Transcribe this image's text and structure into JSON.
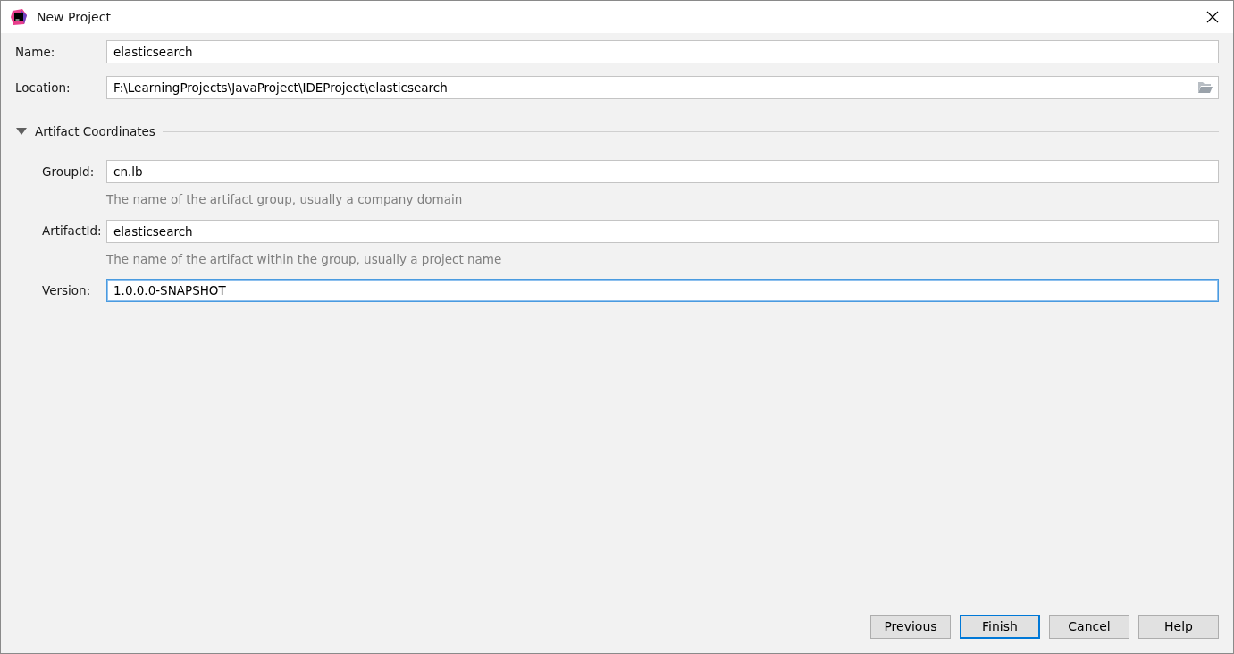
{
  "window": {
    "title": "New Project"
  },
  "fields": [
    {
      "label": "Name:",
      "value": "elasticsearch",
      "focused": false,
      "kind": "text"
    },
    {
      "label": "Location:",
      "value": "F:\\LearningProjects\\JavaProject\\IDEProject\\elasticsearch",
      "focused": false,
      "kind": "folder"
    }
  ],
  "section": {
    "title": "Artifact Coordinates",
    "expanded": true,
    "fields": [
      {
        "label": "GroupId:",
        "value": "cn.lb",
        "hint": "The name of the artifact group, usually a company domain",
        "focused": false
      },
      {
        "label": "ArtifactId:",
        "value": "elasticsearch",
        "hint": "The name of the artifact within the group, usually a project name",
        "focused": false
      },
      {
        "label": "Version:",
        "value": "1.0.0.0-SNAPSHOT",
        "focused": true
      }
    ]
  },
  "buttons": [
    {
      "label": "Previous",
      "default": false
    },
    {
      "label": "Finish",
      "default": true
    },
    {
      "label": "Cancel",
      "default": false
    },
    {
      "label": "Help",
      "default": false
    }
  ]
}
